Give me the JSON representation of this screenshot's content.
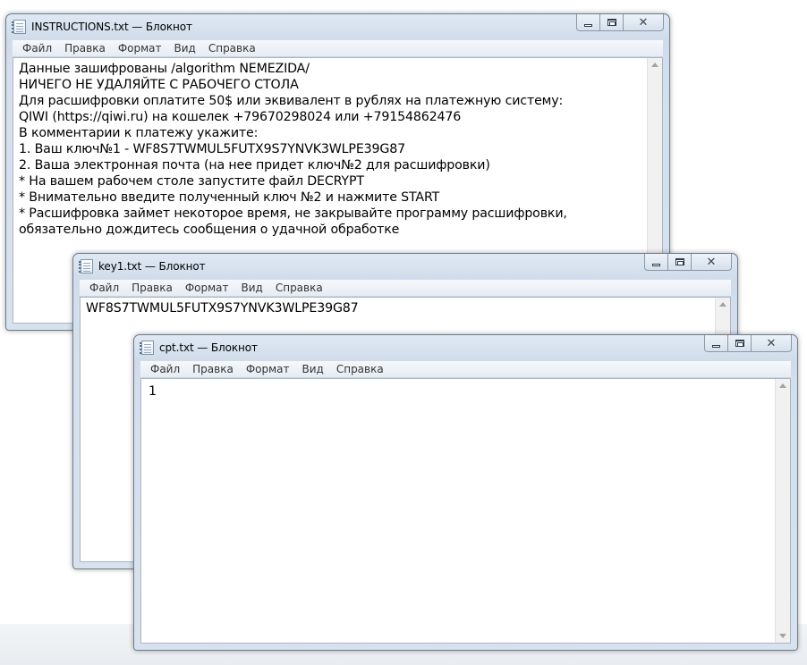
{
  "windows": {
    "instructions": {
      "title": "INSTRUCTIONS.txt — Блокнот",
      "content": "Данные зашифрованы /algorithm NEMEZIDA/\nНИЧЕГО НЕ УДАЛЯЙТЕ С РАБОЧЕГО СТОЛА\nДля расшифровки оплатите 50$ или эквивалент в рублях на платежную систему:\nQIWI (https://qiwi.ru) на кошелек +79670298024 или +79154862476\nВ комментарии к платежу укажите:\n1. Ваш ключ№1 - WF8S7TWMUL5FUTX9S7YNVK3WLPE39G87\n2. Ваша электронная почта (на нее придет ключ№2 для расшифровки)\n* На вашем рабочем столе запустите файл DECRYPT\n* Внимательно введите полученный ключ №2 и нажмите START\n* Расшифровка займет некоторое время, не закрывайте программу расшифровки,\nобязательно дождитесь сообщения о удачной обработке"
    },
    "key1": {
      "title": "key1.txt — Блокнот",
      "content": "WF8S7TWMUL5FUTX9S7YNVK3WLPE39G87"
    },
    "cpt": {
      "title": "cpt.txt — Блокнот",
      "content": "1"
    }
  },
  "menu": {
    "file": "Файл",
    "edit": "Правка",
    "format": "Формат",
    "view": "Вид",
    "help": "Справка"
  },
  "icons": {
    "app": "notepad-icon",
    "minimize": "minimize-icon",
    "maximize": "maximize-icon",
    "close": "close-icon"
  }
}
